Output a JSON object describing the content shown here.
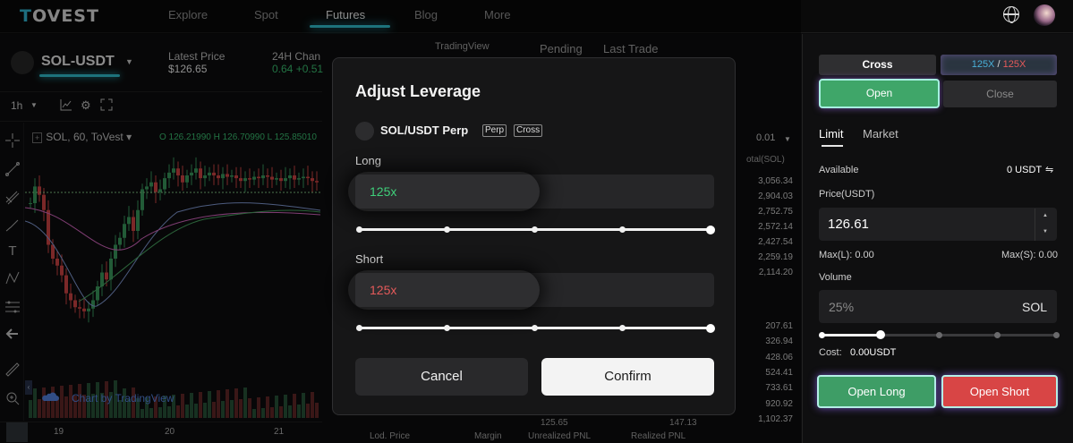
{
  "nav": {
    "logo": "TOVEST",
    "items": [
      "Explore",
      "Spot",
      "Futures",
      "Blog",
      "More"
    ],
    "active": "Futures"
  },
  "market": {
    "pair": "SOL-USDT",
    "latest_price_label": "Latest Price",
    "latest_price": "$126.65",
    "change_label": "24H Chan",
    "change_value": "0.64 +0.51"
  },
  "chart": {
    "timeframe": "1h",
    "legend": "SOL, 60, ToVest",
    "ohlc": "O 126.21990  H 126.70990  L 125.85010",
    "attribution": "Chart by TradingView",
    "x_labels": [
      "19",
      "20",
      "21"
    ]
  },
  "orderbook": {
    "tabs": [
      "TradingView",
      "Pending",
      "Last Trade"
    ],
    "step": "0.01",
    "total_label": "otal(SOL)",
    "asks": [
      "3,056.34",
      "2,904.03",
      "2,752.75",
      "2,572.14",
      "2,427.54",
      "2,259.19",
      "2,114.20"
    ],
    "bids": [
      "207.61",
      "326.94",
      "428.06",
      "524.41",
      "733.61",
      "920.92",
      "1,102.37"
    ],
    "bottom_headers": [
      "Lod. Price",
      "Margin",
      "Unrealized PNL",
      "Realized PNL"
    ],
    "bottom_values": [
      "125.65",
      "147.13"
    ]
  },
  "modal": {
    "title": "Adjust Leverage",
    "pair": "SOL/USDT Perp",
    "badges": [
      "Perp",
      "Cross"
    ],
    "long_label": "Long",
    "long_value": "125x",
    "short_label": "Short",
    "short_value": "125x",
    "long_slider_level": 1.0,
    "short_slider_level": 1.0,
    "cancel": "Cancel",
    "confirm": "Confirm"
  },
  "panel": {
    "margin_mode": "Cross",
    "leverage_long": "125X",
    "leverage_sep": "/",
    "leverage_short": "125X",
    "open": "Open",
    "close": "Close",
    "order_types": [
      "Limit",
      "Market"
    ],
    "available_label": "Available",
    "available_value": "0 USDT",
    "price_label": "Price(USDT)",
    "price_value": "126.61",
    "max_long": "Max(L): 0.00",
    "max_short": "Max(S): 0.00",
    "volume_label": "Volume",
    "volume_placeholder": "25%",
    "volume_unit": "SOL",
    "volume_level": 0.25,
    "cost_label": "Cost:",
    "cost_value": "0.00USDT",
    "open_long": "Open Long",
    "open_short": "Open Short"
  },
  "colors": {
    "accent": "#35d0e0",
    "buy": "#3fa669",
    "sell": "#d84545",
    "long_text": "#3fcf7a",
    "short_text": "#e55a5a"
  }
}
